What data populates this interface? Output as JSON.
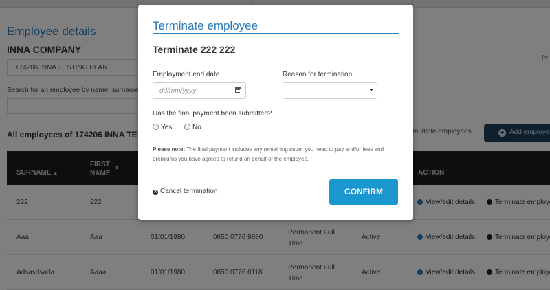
{
  "background": {
    "page_title": "Employee details",
    "company": "INNA COMPANY",
    "plan_select_value": "174206 INNA TESTING PLAN",
    "search_label": "Search for an employee by name, surname",
    "side_text": "Pr",
    "all_employees_heading": "All employees of 174206 INNA TE",
    "multiple_text": "multiple employees",
    "add_button_label": "Add employee",
    "table": {
      "headers": {
        "surname": "SURNAME",
        "first_name": "FIRST NAME",
        "action": "ACTION"
      },
      "rows": [
        {
          "surname": "222",
          "first": "222",
          "dob": "",
          "tfn": "",
          "type": "",
          "status": "",
          "view": "View/edit details",
          "terminate": "Terminate employee"
        },
        {
          "surname": "Aaa",
          "first": "Aaa",
          "dob": "01/01/1980",
          "tfn": "0650 0776 9880",
          "type": "Permanent Full Time",
          "status": "Active",
          "view": "View/edit details",
          "terminate": "Terminate employee"
        },
        {
          "surname": "Adsasdsada",
          "first": "Aaaa",
          "dob": "01/01/1980",
          "tfn": "0650 0776 6118",
          "type": "Permanent Full Time",
          "status": "Active",
          "view": "View/edit details",
          "terminate": "Terminate employee"
        }
      ]
    }
  },
  "modal": {
    "title": "Terminate employee",
    "subtitle": "Terminate 222 222",
    "end_date_label": "Employment end date",
    "end_date_placeholder": "dd/mm/yyyy",
    "reason_label": "Reason for termination",
    "reason_value": "",
    "final_payment_question": "Has the final payment been submitted?",
    "yes_label": "Yes",
    "no_label": "No",
    "note_bold": "Please note:",
    "note_text": " The final payment includes any remaining super you need to pay and/or fees and premiums you have agreed to refund on behalf of the employee.",
    "cancel_label": "Cancel termination",
    "confirm_label": "CONFIRM"
  },
  "colors": {
    "accent_blue": "#2a7ab8",
    "confirm_blue": "#1a97cf",
    "table_header": "#1c1c1c",
    "add_button": "#1d3e5a"
  }
}
